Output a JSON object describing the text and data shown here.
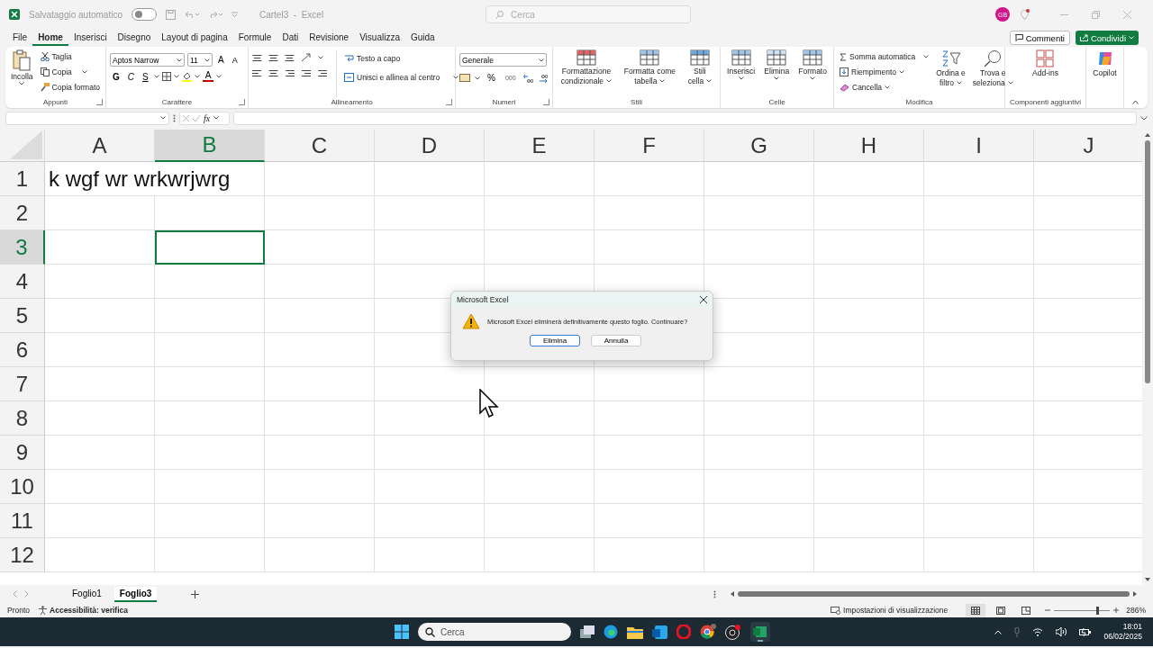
{
  "title_bar": {
    "autosave_label": "Salvataggio automatico",
    "autosave_on": false,
    "document_title": "Cartel3  -  Excel",
    "search_placeholder": "Cerca",
    "avatar_initials": "GB"
  },
  "menu_tabs": [
    {
      "label": "File",
      "selected": false
    },
    {
      "label": "Home",
      "selected": true
    },
    {
      "label": "Inserisci",
      "selected": false
    },
    {
      "label": "Disegno",
      "selected": false
    },
    {
      "label": "Layout di pagina",
      "selected": false
    },
    {
      "label": "Formule",
      "selected": false
    },
    {
      "label": "Dati",
      "selected": false
    },
    {
      "label": "Revisione",
      "selected": false
    },
    {
      "label": "Visualizza",
      "selected": false
    },
    {
      "label": "Guida",
      "selected": false
    }
  ],
  "share": {
    "comments": "Commenti",
    "share": "Condividi"
  },
  "ribbon": {
    "clipboard": {
      "paste": "Incolla",
      "cut": "Taglia",
      "copy": "Copia",
      "format_painter": "Copia formato",
      "group": "Appunti"
    },
    "font": {
      "font_name": "Aptos Narrow",
      "font_size": "11",
      "grow": "A",
      "shrink": "A",
      "bold": "G",
      "italic": "C",
      "underline": "S",
      "font_color": "A",
      "group": "Carattere"
    },
    "alignment": {
      "wrap": "Testo a capo",
      "merge": "Unisci e allinea al centro",
      "group": "Allineamento"
    },
    "number": {
      "format": "Generale",
      "percent": "%",
      "thousands": "000",
      "group": "Numeri"
    },
    "styles": {
      "conditional": [
        "Formattazione",
        "condizionale"
      ],
      "table": [
        "Formatta come",
        "tabella"
      ],
      "cell_styles": [
        "Stili",
        "cella"
      ],
      "group": "Stili"
    },
    "cells": {
      "insert": "Inserisci",
      "delete": "Elimina",
      "format": "Formato",
      "group": "Celle"
    },
    "editing": {
      "autosum": "Somma automatica",
      "fill": "Riempimento",
      "clear": "Cancella",
      "sort": [
        "Ordina e",
        "filtro"
      ],
      "find": [
        "Trova e",
        "seleziona"
      ],
      "group": "Modifica"
    },
    "addins": {
      "addins": "Add-ins",
      "group": "Componenti aggiuntivi"
    },
    "copilot": {
      "label": "Copilot"
    }
  },
  "formula_bar": {
    "function_label": "fx"
  },
  "grid": {
    "columns": [
      {
        "label": "A",
        "selected": false
      },
      {
        "label": "B",
        "selected": true
      },
      {
        "label": "C",
        "selected": false
      },
      {
        "label": "D",
        "selected": false
      },
      {
        "label": "E",
        "selected": false
      },
      {
        "label": "F",
        "selected": false
      },
      {
        "label": "G",
        "selected": false
      },
      {
        "label": "H",
        "selected": false
      },
      {
        "label": "I",
        "selected": false
      },
      {
        "label": "J",
        "selected": false
      }
    ],
    "rows": [
      {
        "label": "1",
        "selected": false,
        "cells": [
          "k wgf wr wrkwrjwrg"
        ]
      },
      {
        "label": "2",
        "selected": false,
        "cells": []
      },
      {
        "label": "3",
        "selected": true,
        "cells": []
      },
      {
        "label": "4",
        "selected": false,
        "cells": []
      },
      {
        "label": "5",
        "selected": false,
        "cells": []
      },
      {
        "label": "6",
        "selected": false,
        "cells": []
      },
      {
        "label": "7",
        "selected": false,
        "cells": []
      },
      {
        "label": "8",
        "selected": false,
        "cells": []
      },
      {
        "label": "9",
        "selected": false,
        "cells": []
      },
      {
        "label": "10",
        "selected": false,
        "cells": []
      },
      {
        "label": "11",
        "selected": false,
        "cells": []
      },
      {
        "label": "12",
        "selected": false,
        "cells": []
      }
    ]
  },
  "sheets": [
    {
      "label": "Foglio1",
      "selected": false
    },
    {
      "label": "Foglio3",
      "selected": true
    }
  ],
  "status_bar": {
    "ready": "Pronto",
    "accessibility": "Accessibilità: verifica",
    "display_settings": "Impostazioni di visualizzazione",
    "views": [
      {
        "kind": "normal",
        "selected": true
      },
      {
        "kind": "page_layout",
        "selected": false
      },
      {
        "kind": "page_break",
        "selected": false
      }
    ],
    "zoom": {
      "level": 0.77,
      "reading": "286%"
    }
  },
  "dialog": {
    "title": "Microsoft Excel",
    "message": "Microsoft Excel eliminerà definitivamente questo foglio. Continuare?",
    "buttons": [
      {
        "label": "Elimina",
        "selected": true
      },
      {
        "label": "Annulla",
        "selected": false
      }
    ]
  },
  "taskbar": {
    "search_placeholder": "Cerca",
    "time": "18:01",
    "date": "06/02/2025"
  }
}
